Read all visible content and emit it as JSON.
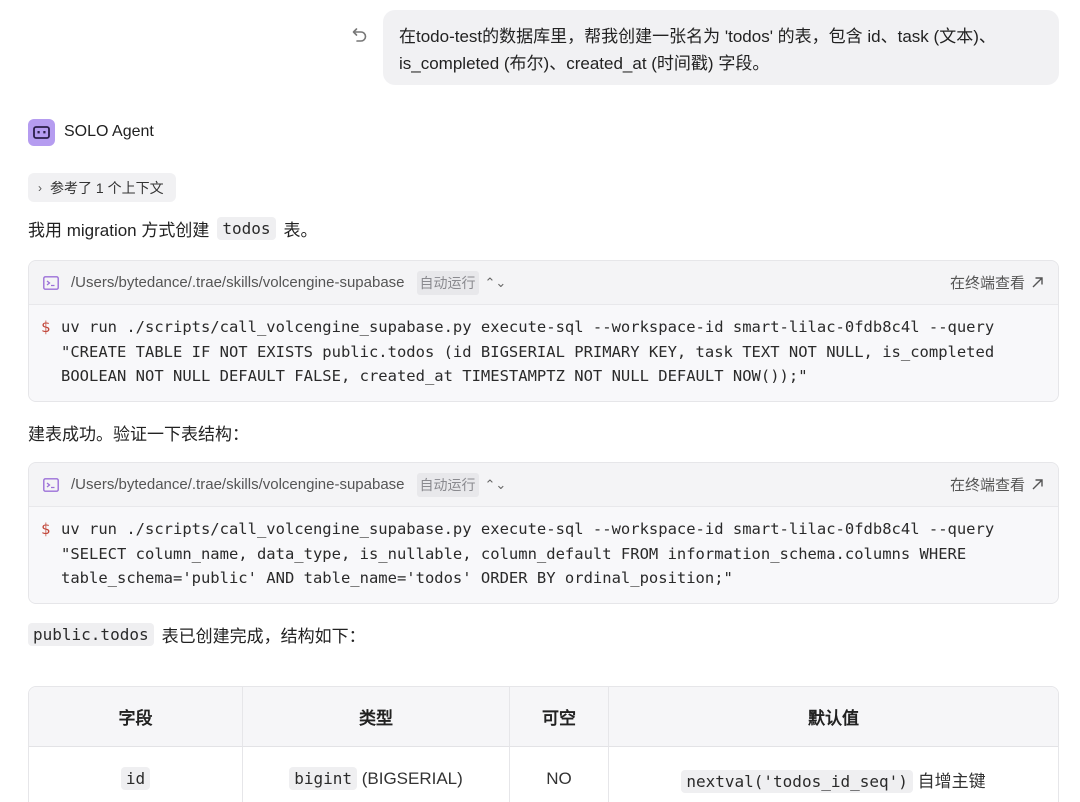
{
  "user_message": {
    "line1": "在todo-test的数据库里，帮我创建一张名为 'todos' 的表，包含 id、task (文本)、",
    "line2": "is_completed (布尔)、created_at (时间戳) 字段。"
  },
  "agent": {
    "name": "SOLO Agent"
  },
  "context_pill": {
    "label": "参考了 1 个上下文"
  },
  "para1": {
    "before": "我用 migration 方式创建",
    "code": "todos",
    "after": "表。"
  },
  "command_blocks": [
    {
      "path": "/Users/bytedance/.trae/skills/volcengine-supabase",
      "auto_label": "自动运行",
      "view_label": "在终端查看",
      "prompt": "$",
      "lines": [
        "uv run ./scripts/call_volcengine_supabase.py execute-sql --workspace-id smart-lilac-0fdb8c4l --query",
        "\"CREATE TABLE IF NOT EXISTS public.todos (id BIGSERIAL PRIMARY KEY, task TEXT NOT NULL, is_completed",
        "BOOLEAN NOT NULL DEFAULT FALSE, created_at TIMESTAMPTZ NOT NULL DEFAULT NOW());\""
      ]
    },
    {
      "path": "/Users/bytedance/.trae/skills/volcengine-supabase",
      "auto_label": "自动运行",
      "view_label": "在终端查看",
      "prompt": "$",
      "lines": [
        "uv run ./scripts/call_volcengine_supabase.py execute-sql --workspace-id smart-lilac-0fdb8c4l --query",
        "\"SELECT column_name, data_type, is_nullable, column_default FROM information_schema.columns WHERE",
        "table_schema='public' AND table_name='todos' ORDER BY ordinal_position;\""
      ]
    }
  ],
  "para2": {
    "text": "建表成功。验证一下表结构："
  },
  "para3": {
    "code": "public.todos",
    "after": "表已创建完成，结构如下："
  },
  "table": {
    "headers": [
      "字段",
      "类型",
      "可空",
      "默认值"
    ],
    "rows": [
      {
        "field": "id",
        "type_code": "bigint",
        "type_note": "(BIGSERIAL)",
        "nullable": "NO",
        "default_code": "nextval('todos_id_seq')",
        "default_note": "自增主键"
      }
    ]
  },
  "colors": {
    "prompt": "#c2483b",
    "avatar": "#b59cf0",
    "terminal_icon": "#9b6fd8"
  }
}
